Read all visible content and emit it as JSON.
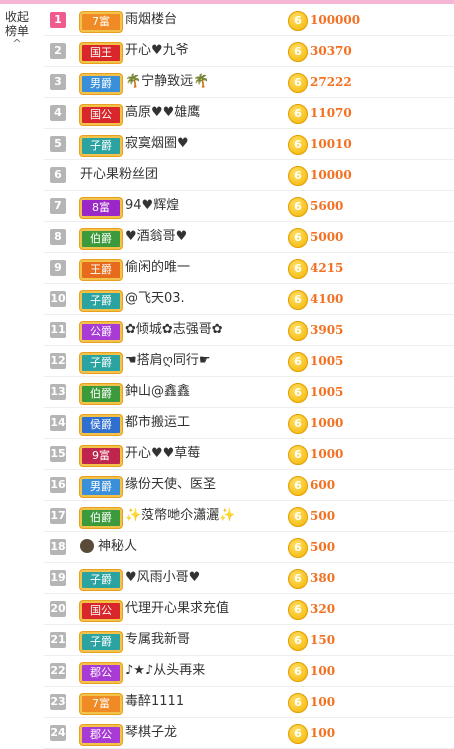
{
  "panel": {
    "collapse_label_1": "收起",
    "collapse_label_2": "榜单",
    "collapse_icon": "chevron-up-icon"
  },
  "coin_glyph": "6",
  "rows": [
    {
      "rank": "1",
      "badge": "7富",
      "badge_color": "#f08a24",
      "name": "雨烟楼台",
      "score": "100000"
    },
    {
      "rank": "2",
      "badge": "国王",
      "badge_color": "#d9262b",
      "name": "开心♥九爷",
      "score": "30370"
    },
    {
      "rank": "3",
      "badge": "男爵",
      "badge_color": "#3a8fd9",
      "name": "🌴宁静致远🌴",
      "score": "27222"
    },
    {
      "rank": "4",
      "badge": "国公",
      "badge_color": "#d9262b",
      "name": "高原♥♥雄鹰",
      "score": "11070"
    },
    {
      "rank": "5",
      "badge": "子爵",
      "badge_color": "#2ba3a0",
      "name": "寂寞烟圈♥",
      "score": "10010"
    },
    {
      "rank": "6",
      "badge": "",
      "badge_color": "",
      "name": "开心果粉丝团",
      "score": "10000"
    },
    {
      "rank": "7",
      "badge": "8富",
      "badge_color": "#9b27c9",
      "name": "94♥辉煌",
      "score": "5600"
    },
    {
      "rank": "8",
      "badge": "伯爵",
      "badge_color": "#3b9a3b",
      "name": "♥酒翁哥♥",
      "score": "5000"
    },
    {
      "rank": "9",
      "badge": "王爵",
      "badge_color": "#e86a1c",
      "name": "偷闲的唯一",
      "score": "4215"
    },
    {
      "rank": "10",
      "badge": "子爵",
      "badge_color": "#2ba3a0",
      "name": "@飞天03.",
      "score": "4100"
    },
    {
      "rank": "11",
      "badge": "公爵",
      "badge_color": "#a83bd6",
      "name": "✿倾城✿志强哥✿",
      "score": "3905"
    },
    {
      "rank": "12",
      "badge": "子爵",
      "badge_color": "#2ba3a0",
      "name": "☚搭肩ღ同行☛",
      "score": "1005"
    },
    {
      "rank": "13",
      "badge": "伯爵",
      "badge_color": "#3b9a3b",
      "name": "鈡山@鑫鑫",
      "score": "1005"
    },
    {
      "rank": "14",
      "badge": "侯爵",
      "badge_color": "#2f6fd0",
      "name": "都市搬运工",
      "score": "1000"
    },
    {
      "rank": "15",
      "badge": "9富",
      "badge_color": "#c0264d",
      "name": "开心♥♥草莓",
      "score": "1000"
    },
    {
      "rank": "16",
      "badge": "男爵",
      "badge_color": "#3a8fd9",
      "name": "缘份天使、医圣",
      "score": "600"
    },
    {
      "rank": "17",
      "badge": "伯爵",
      "badge_color": "#3b9a3b",
      "name": "✨莈幣哋尒瀟灑✨",
      "score": "500"
    },
    {
      "rank": "18",
      "badge": "",
      "badge_color": "",
      "name": "神秘人",
      "score": "500",
      "avatar": true
    },
    {
      "rank": "19",
      "badge": "子爵",
      "badge_color": "#2ba3a0",
      "name": "♥风雨小哥♥",
      "score": "380"
    },
    {
      "rank": "20",
      "badge": "国公",
      "badge_color": "#d9262b",
      "name": "代理开心果求充值",
      "score": "320"
    },
    {
      "rank": "21",
      "badge": "子爵",
      "badge_color": "#2ba3a0",
      "name": "专属我新哥",
      "score": "150"
    },
    {
      "rank": "22",
      "badge": "郡公",
      "badge_color": "#a83bd6",
      "name": "♪★♪从头再来",
      "score": "100"
    },
    {
      "rank": "23",
      "badge": "7富",
      "badge_color": "#f08a24",
      "name": "毒醉1111",
      "score": "100"
    },
    {
      "rank": "24",
      "badge": "郡公",
      "badge_color": "#a83bd6",
      "name": "琴棋子龙",
      "score": "100"
    }
  ]
}
